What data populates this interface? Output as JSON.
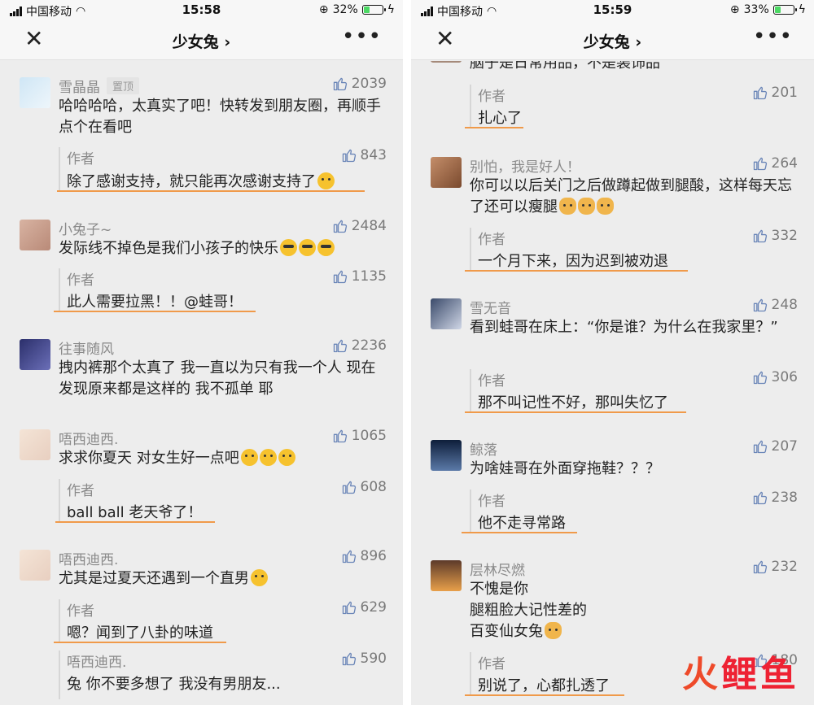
{
  "left": {
    "status": {
      "carrier": "中国移动",
      "time": "15:58",
      "battery": "32%",
      "battery_level": 0.32
    },
    "nav": {
      "title": "少女兔 ›",
      "close": "✕",
      "more": "•••"
    },
    "comments": [
      {
        "nick": "雪晶晶",
        "pin": "置顶",
        "likes": "2039",
        "text": "哈哈哈哈，太真实了吧！快转发到朋友圈，再顺手点个在看吧",
        "author_label": "作者",
        "reply_likes": "843",
        "reply": "除了感谢支持，就只能再次感谢支持了"
      },
      {
        "nick": "小兔子~",
        "likes": "2484",
        "text": "发际线不掉色是我们小孩子的快乐",
        "author_label": "作者",
        "reply_likes": "1135",
        "reply": "此人需要拉黑！！@蛙哥！"
      },
      {
        "nick": "往事随风",
        "likes": "2236",
        "text": "拽内裤那个太真了 我一直以为只有我一个人 现在发现原来都是这样的 我不孤单 耶"
      },
      {
        "nick": "唔西迪西.",
        "likes": "1065",
        "text": "求求你夏天 对女生好一点吧",
        "author_label": "作者",
        "reply_likes": "608",
        "reply": "ball ball 老天爷了！"
      },
      {
        "nick": "唔西迪西.",
        "likes": "896",
        "text": "尤其是过夏天还遇到一个直男",
        "author_label": "作者",
        "reply_likes": "629",
        "reply": "嗯？闻到了八卦的味道"
      },
      {
        "nick": "唔西迪西.",
        "likes": "590",
        "text": "兔 你不要多想了 我没有男朋友..."
      }
    ]
  },
  "right": {
    "status": {
      "carrier": "中国移动",
      "time": "15:59",
      "battery": "33%",
      "battery_level": 0.33
    },
    "nav": {
      "title": "少女兔 ›",
      "close": "✕",
      "more": "•••"
    },
    "top_text": "脑子是日常用品，不是装饰品",
    "top_reply": {
      "author_label": "作者",
      "likes": "201",
      "text": "扎心了"
    },
    "comments": [
      {
        "nick": "别怕，我是好人！",
        "likes": "264",
        "text": "你可以以后关门之后做蹲起做到腿酸，这样每天忘了还可以瘦腿",
        "author_label": "作者",
        "reply_likes": "332",
        "reply": "一个月下来，因为迟到被劝退"
      },
      {
        "nick": "雪无音",
        "likes": "248",
        "text": "看到蛙哥在床上：“你是谁？为什么在我家里？”",
        "author_label": "作者",
        "reply_likes": "306",
        "reply": "那不叫记性不好，那叫失忆了"
      },
      {
        "nick": "鲸落",
        "likes": "207",
        "text": "为啥娃哥在外面穿拖鞋？？？",
        "author_label": "作者",
        "reply_likes": "238",
        "reply": "他不走寻常路"
      },
      {
        "nick": "层林尽燃",
        "likes": "232",
        "text_lines": [
          "不愧是你",
          "腿粗脸大记性差的",
          "百变仙女兔"
        ],
        "author_label": "作者",
        "reply_likes": "180",
        "reply": "别说了，心都扎透了"
      }
    ]
  },
  "watermark": {
    "part1": "火",
    "part2": "鲤鱼"
  }
}
